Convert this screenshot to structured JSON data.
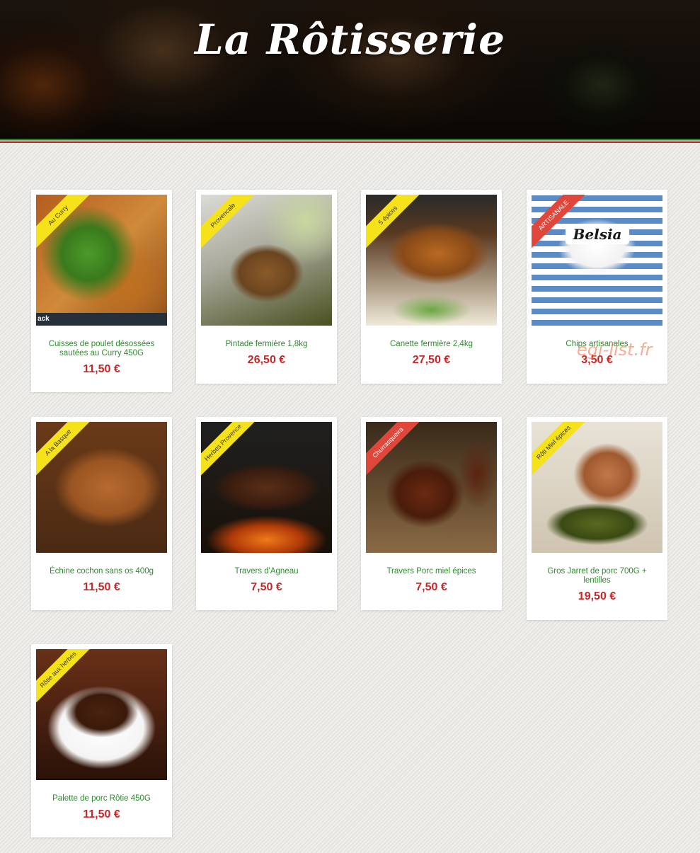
{
  "header": {
    "title": "La Rôtisserie"
  },
  "watermark": "egi-list.fr",
  "colors": {
    "product_name": "#2e8b2e",
    "price": "#c62828",
    "ribbon_yellow": "#f6e21a",
    "ribbon_red": "#e0463a",
    "stripe_green": "#2e7d32",
    "stripe_red": "#c62828"
  },
  "products": [
    {
      "badge": "Au Curry",
      "badge_color": "yellow",
      "name": "Cuisses de poulet désossées sautées au Curry 450G",
      "price": "11,50 €",
      "image_overlay_text": "ack"
    },
    {
      "badge": "Provencale",
      "badge_color": "yellow",
      "name": "Pintade fermière 1,8kg",
      "price": "26,50 €"
    },
    {
      "badge": "5 épices",
      "badge_color": "yellow",
      "name": "Canette fermière 2,4kg",
      "price": "27,50 €"
    },
    {
      "badge": "ARTISANALE",
      "badge_color": "red",
      "name": "Chips artisanales",
      "price": "3,50 €",
      "image_brand": "Belsia"
    },
    {
      "badge": "A la Basque",
      "badge_color": "yellow",
      "name": "Échine cochon sans os 400g",
      "price": "11,50 €"
    },
    {
      "badge": "Herbes Provence",
      "badge_color": "yellow",
      "name": "Travers d'Agneau",
      "price": "7,50 €"
    },
    {
      "badge": "Churrasqueira",
      "badge_color": "red",
      "name": "Travers Porc miel épices",
      "price": "7,50 €"
    },
    {
      "badge": "Rôti Miel épices",
      "badge_color": "yellow",
      "name": "Gros Jarret de porc 700G + lentilles",
      "price": "19,50 €"
    },
    {
      "badge": "Rôtie aux herbes",
      "badge_color": "yellow",
      "name": "Palette de porc Rôtie 450G",
      "price": "11,50 €"
    }
  ]
}
